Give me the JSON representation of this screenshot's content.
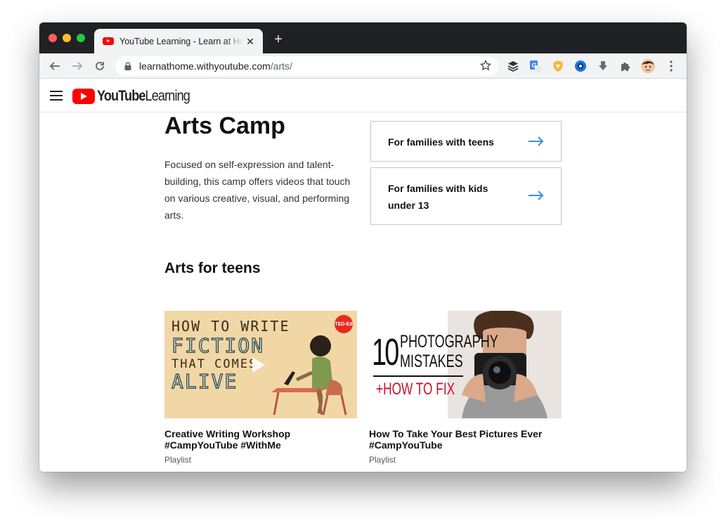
{
  "browser": {
    "tab_title": "YouTube Learning - Learn at Home",
    "tab_close": "✕",
    "new_tab": "+",
    "url_host": "learnathome.withyoutube.com",
    "url_path": "/arts/"
  },
  "app": {
    "logo_brand": "YouTube",
    "logo_product": "Learning"
  },
  "main": {
    "title": "Arts Camp",
    "description": "Focused on self-expression and talent-building, this camp offers videos that touch on various creative, visual, and performing arts.",
    "family_links": [
      {
        "label": "For families with teens"
      },
      {
        "label": "For families with kids under 13"
      }
    ],
    "section_title": "Arts for teens",
    "videos": [
      {
        "title": "Creative Writing Workshop #CampYouTube #WithMe",
        "type": "Playlist",
        "thumb_lines": [
          "HOW TO WRITE",
          "FICTION",
          "THAT COMES",
          "ALIVE"
        ],
        "badge": "TED-Ed"
      },
      {
        "title": "How To Take Your Best Pictures Ever #CampYouTube",
        "type": "Playlist",
        "thumb_number": "10",
        "thumb_lines": [
          "PHOTOGRAPHY",
          "MISTAKES"
        ],
        "thumb_tagline": "+HOW TO FIX"
      }
    ]
  },
  "colors": {
    "accent_arrow": "#3b8fe0",
    "youtube_red": "#ff0000"
  }
}
